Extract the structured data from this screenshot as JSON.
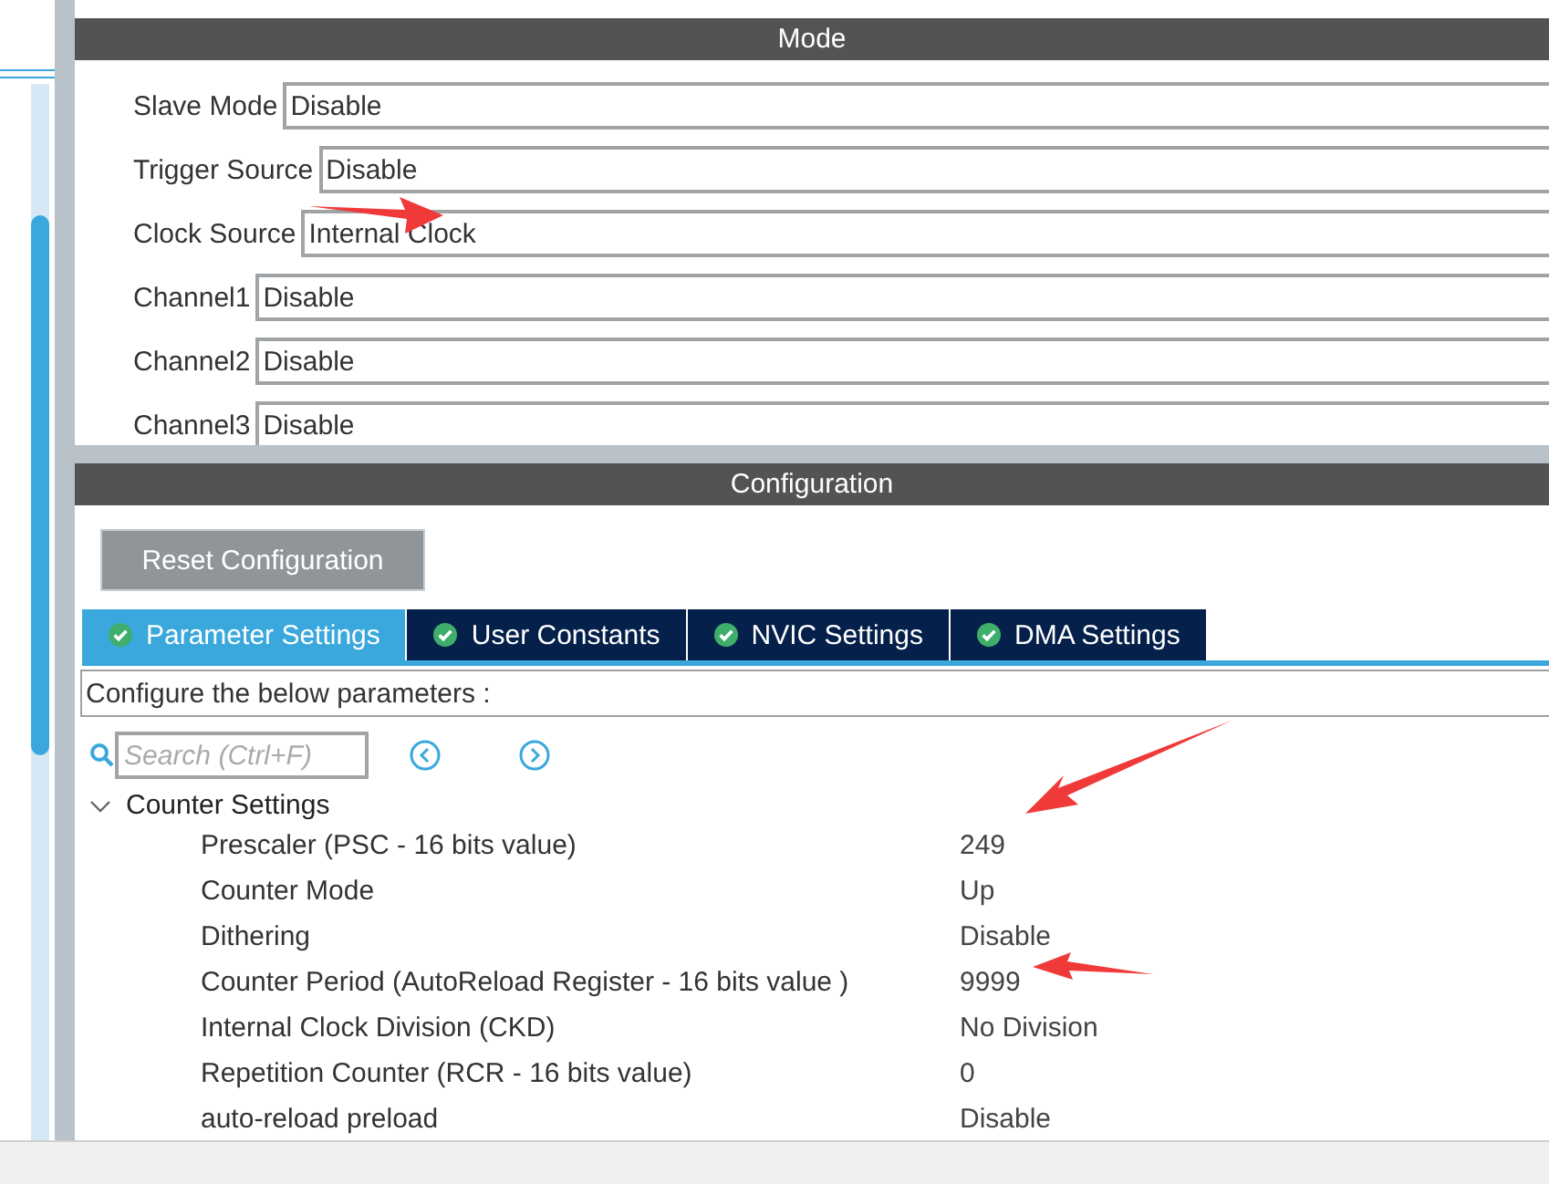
{
  "mode": {
    "title": "Mode",
    "fields": [
      {
        "label": "Slave Mode",
        "value": "Disable"
      },
      {
        "label": "Trigger Source",
        "value": "Disable"
      },
      {
        "label": "Clock Source",
        "value": "Internal Clock"
      },
      {
        "label": "Channel1",
        "value": "Disable"
      },
      {
        "label": "Channel2",
        "value": "Disable"
      },
      {
        "label": "Channel3",
        "value": "Disable"
      }
    ]
  },
  "configuration": {
    "title": "Configuration",
    "reset_button": "Reset Configuration",
    "tabs": [
      {
        "label": "Parameter Settings",
        "selected": true
      },
      {
        "label": "User Constants",
        "selected": false
      },
      {
        "label": "NVIC Settings",
        "selected": false
      },
      {
        "label": "DMA Settings",
        "selected": false
      }
    ],
    "description": "Configure the below parameters :",
    "search": {
      "placeholder": "Search (Ctrl+F)"
    },
    "group": {
      "label": "Counter Settings",
      "expanded": true,
      "rows": [
        {
          "name": "Prescaler (PSC - 16 bits value)",
          "value": "249"
        },
        {
          "name": "Counter Mode",
          "value": "Up"
        },
        {
          "name": "Dithering",
          "value": "Disable"
        },
        {
          "name": "Counter Period (AutoReload Register - 16 bits value )",
          "value": "9999"
        },
        {
          "name": "Internal Clock Division (CKD)",
          "value": "No Division"
        },
        {
          "name": "Repetition Counter (RCR - 16 bits value)",
          "value": "0"
        },
        {
          "name": "auto-reload preload",
          "value": "Disable"
        }
      ]
    }
  }
}
